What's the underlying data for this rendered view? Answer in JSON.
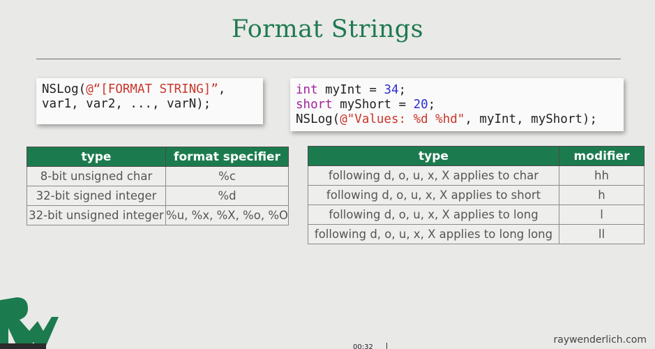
{
  "slide": {
    "title": "Format Strings",
    "footer": "raywenderlich.com",
    "timer": "00:32"
  },
  "code1": {
    "fn": "NSLog(",
    "str": "@“[FORMAT STRING]”",
    "tail": ",",
    "line2": "var1, var2, ..., varN);"
  },
  "code2": {
    "kw_int": "int",
    "decl1": " myInt = ",
    "val1": "34",
    "end1": ";",
    "kw_short": "short",
    "decl2": " myShort = ",
    "val2": "20",
    "end2": ";",
    "fn": "NSLog(",
    "str": "@\"Values: %d %hd\"",
    "args": ", myInt, myShort);"
  },
  "table1": {
    "headers": [
      "type",
      "format specifier"
    ],
    "rows": [
      [
        "8-bit unsigned char",
        "%c"
      ],
      [
        "32-bit signed integer",
        "%d"
      ],
      [
        "32-bit unsigned integer",
        "%u, %x, %X, %o, %O"
      ]
    ]
  },
  "table2": {
    "headers": [
      "type",
      "modifier"
    ],
    "rows": [
      [
        "following d, o, u, x, X applies to char",
        "hh"
      ],
      [
        "following d, o, u, x, X applies to short",
        "h"
      ],
      [
        "following d, o, u, x, X applies to long",
        "l"
      ],
      [
        "following d, o, u, x, X applies to long long",
        "ll"
      ]
    ]
  },
  "colors": {
    "accent": "#1f7a4f",
    "header_bg": "#1c7b4e",
    "keyword": "#a0229b",
    "string": "#c9362a",
    "number": "#2b2fd0"
  },
  "icons": {
    "logo": "rw-logo-icon"
  }
}
